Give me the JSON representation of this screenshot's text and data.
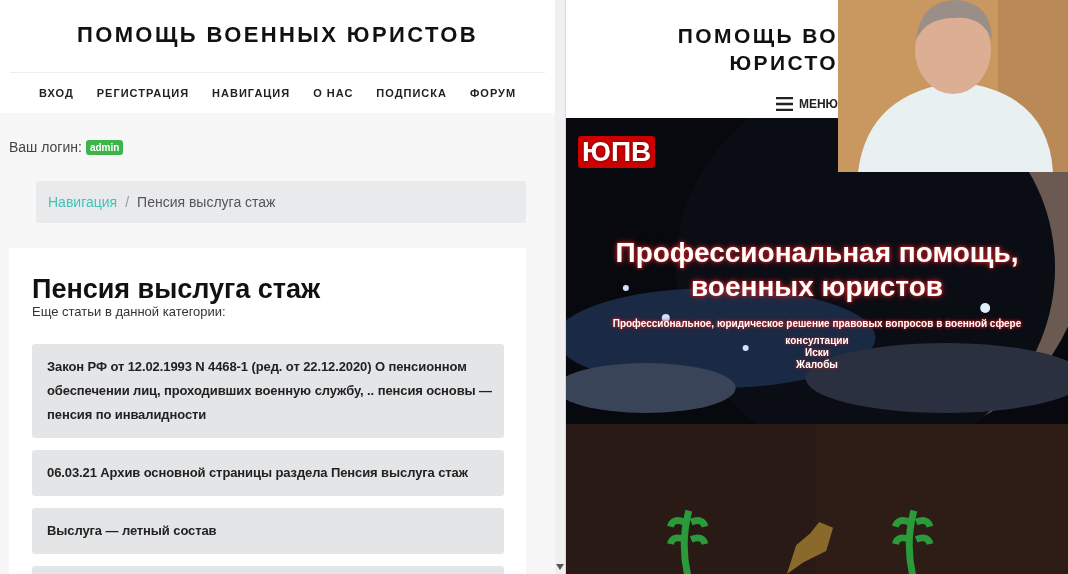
{
  "left_page": {
    "site_title": "ПОМОЩЬ ВОЕННЫХ ЮРИСТОВ",
    "nav": [
      {
        "label": "ВХОД"
      },
      {
        "label": "РЕГИСТРАЦИЯ"
      },
      {
        "label": "НАВИГАЦИЯ"
      },
      {
        "label": "О НАС"
      },
      {
        "label": "ПОДПИСКА"
      },
      {
        "label": "ФОРУМ"
      }
    ],
    "login_label": "Ваш логин:",
    "login_badge": "admin",
    "breadcrumb": [
      {
        "label": "Навигация",
        "kind": "link"
      },
      {
        "label": "/",
        "kind": "separator"
      },
      {
        "label": "Пенсия выслуга стаж",
        "kind": "current"
      }
    ],
    "heading": "Пенсия выслуга стаж",
    "subheading": "Еще статьи в данной категории:",
    "articles": [
      {
        "title": "Закон РФ от 12.02.1993 N 4468-1 (ред. от 22.12.2020) О пенсионном обеспечении лиц, проходивших военную службу, .. пенсия основы — пенсия по инвалидности"
      },
      {
        "title": "06.03.21 Архив основной страницы раздела Пенсия выслуга стаж"
      },
      {
        "title": "Выслуга — летный состав"
      },
      {
        "kind": "stub"
      }
    ]
  },
  "right_page": {
    "site_title_lines": [
      "ПОМОЩЬ ВО",
      "ЮРИСТО"
    ],
    "menu_label": "МЕНЮ",
    "banner": {
      "badge": "ЮПВ",
      "headline_lines": [
        "Профессиональная помощь,",
        "военных юристов"
      ],
      "tagline": "Профессиональное, юридическое решение правовых вопросов в военной сфере",
      "services": [
        "консултации",
        "Иски",
        "Жалобы"
      ]
    }
  }
}
